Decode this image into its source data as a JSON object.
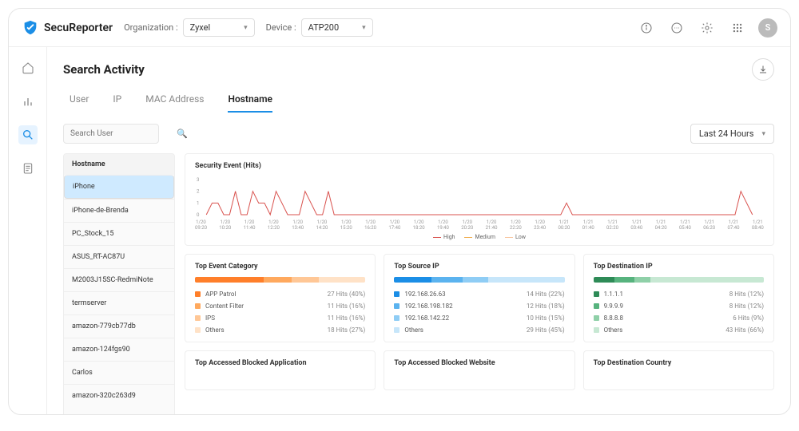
{
  "app_name": "SecuReporter",
  "org_label": "Organization :",
  "org_value": "Zyxel",
  "device_label": "Device :",
  "device_value": "ATP200",
  "avatar_letter": "S",
  "page_title": "Search Activity",
  "tabs": [
    "User",
    "IP",
    "MAC Address",
    "Hostname"
  ],
  "active_tab": 3,
  "search_placeholder": "Search User",
  "range_value": "Last 24 Hours",
  "host_header": "Hostname",
  "hosts": [
    "iPhone",
    "iPhone-de-Brenda",
    "PC_Stock_15",
    "ASUS_RT-AC87U",
    "M2003J15SC-RedmiNote",
    "termserver",
    "amazon-779cb77db",
    "amazon-124fgs90",
    "Carlos",
    "amazon-320c263d9"
  ],
  "host_selected": 0,
  "chart_title": "Security Event (Hits)",
  "chart_data": {
    "type": "line",
    "ylabel": "",
    "ylim": [
      0,
      3
    ],
    "yticks": [
      0,
      1,
      2,
      3
    ],
    "x_ticks": [
      {
        "d": "1/20",
        "t": "09:20"
      },
      {
        "d": "1/20",
        "t": "10:20"
      },
      {
        "d": "1/20",
        "t": "11:40"
      },
      {
        "d": "1/20",
        "t": "12:20"
      },
      {
        "d": "1/20",
        "t": "13:40"
      },
      {
        "d": "1/20",
        "t": "14:20"
      },
      {
        "d": "1/20",
        "t": "15:20"
      },
      {
        "d": "1/20",
        "t": "16:20"
      },
      {
        "d": "1/20",
        "t": "17:40"
      },
      {
        "d": "1/20",
        "t": "18:20"
      },
      {
        "d": "1/20",
        "t": "19:40"
      },
      {
        "d": "1/20",
        "t": "20:20"
      },
      {
        "d": "1/20",
        "t": "21:40"
      },
      {
        "d": "1/20",
        "t": "22:20"
      },
      {
        "d": "1/20",
        "t": "23:40"
      },
      {
        "d": "1/21",
        "t": "00:20"
      },
      {
        "d": "1/21",
        "t": "01:40"
      },
      {
        "d": "1/21",
        "t": "02:20"
      },
      {
        "d": "1/21",
        "t": "03:40"
      },
      {
        "d": "1/21",
        "t": "04:20"
      },
      {
        "d": "1/21",
        "t": "05:40"
      },
      {
        "d": "1/21",
        "t": "06:20"
      },
      {
        "d": "1/21",
        "t": "07:40"
      },
      {
        "d": "1/21",
        "t": "08:40"
      }
    ],
    "series": [
      {
        "name": "High",
        "color": "#d9534f",
        "values": [
          0,
          1,
          1,
          0,
          0,
          2,
          0,
          0,
          2,
          1,
          1,
          0,
          2,
          1,
          0,
          0,
          0,
          2,
          1,
          0,
          0,
          2,
          0,
          0,
          0,
          0,
          0,
          0,
          0,
          0,
          0,
          0,
          0,
          0,
          0,
          0,
          0,
          0,
          0,
          0,
          0,
          0,
          0,
          0,
          0,
          0,
          0,
          0,
          0,
          0,
          0,
          0,
          0,
          0,
          0,
          0,
          0,
          0,
          0,
          0,
          0,
          0,
          1,
          0,
          0,
          0,
          0,
          0,
          0,
          0,
          0,
          0,
          0,
          0,
          0,
          0,
          0,
          0,
          0,
          0,
          0,
          0,
          0,
          0,
          0,
          0,
          0,
          0,
          0,
          0,
          0,
          0,
          2,
          1,
          0
        ]
      },
      {
        "name": "Medium",
        "color": "#f0ad4e"
      },
      {
        "name": "Low",
        "color": "#f7c59f"
      }
    ],
    "legend": [
      "High",
      "Medium",
      "Low"
    ]
  },
  "colors": {
    "orange": [
      "#ff7f2a",
      "#ffa95e",
      "#ffc796",
      "#ffe2c7"
    ],
    "blue": [
      "#1b8ee6",
      "#5bb3ef",
      "#8fcdf5",
      "#c7e6fa"
    ],
    "green": [
      "#2e8b57",
      "#57b37e",
      "#8fd0a8",
      "#c7e8d3"
    ]
  },
  "cards_row1": [
    {
      "title": "Top Event Category",
      "palette": "orange",
      "items": [
        {
          "label": "APP Patrol",
          "hits": 27,
          "pct": 40
        },
        {
          "label": "Content Filter",
          "hits": 11,
          "pct": 16
        },
        {
          "label": "IPS",
          "hits": 11,
          "pct": 16
        },
        {
          "label": "Others",
          "hits": 18,
          "pct": 27
        }
      ]
    },
    {
      "title": "Top Source IP",
      "palette": "blue",
      "items": [
        {
          "label": "192.168.26.63",
          "hits": 14,
          "pct": 22
        },
        {
          "label": "192.168.198.182",
          "hits": 12,
          "pct": 18
        },
        {
          "label": "192.168.142.22",
          "hits": 10,
          "pct": 15
        },
        {
          "label": "Others",
          "hits": 29,
          "pct": 45
        }
      ]
    },
    {
      "title": "Top Destination IP",
      "palette": "green",
      "items": [
        {
          "label": "1.1.1.1",
          "hits": 8,
          "pct": 12
        },
        {
          "label": "9.9.9.9",
          "hits": 8,
          "pct": 12
        },
        {
          "label": "8.8.8.8",
          "hits": 6,
          "pct": 9
        },
        {
          "label": "Others",
          "hits": 43,
          "pct": 66
        }
      ]
    }
  ],
  "cards_row2": [
    {
      "title": "Top Accessed Blocked Application"
    },
    {
      "title": "Top Accessed Blocked Website"
    },
    {
      "title": "Top Destination Country"
    }
  ]
}
